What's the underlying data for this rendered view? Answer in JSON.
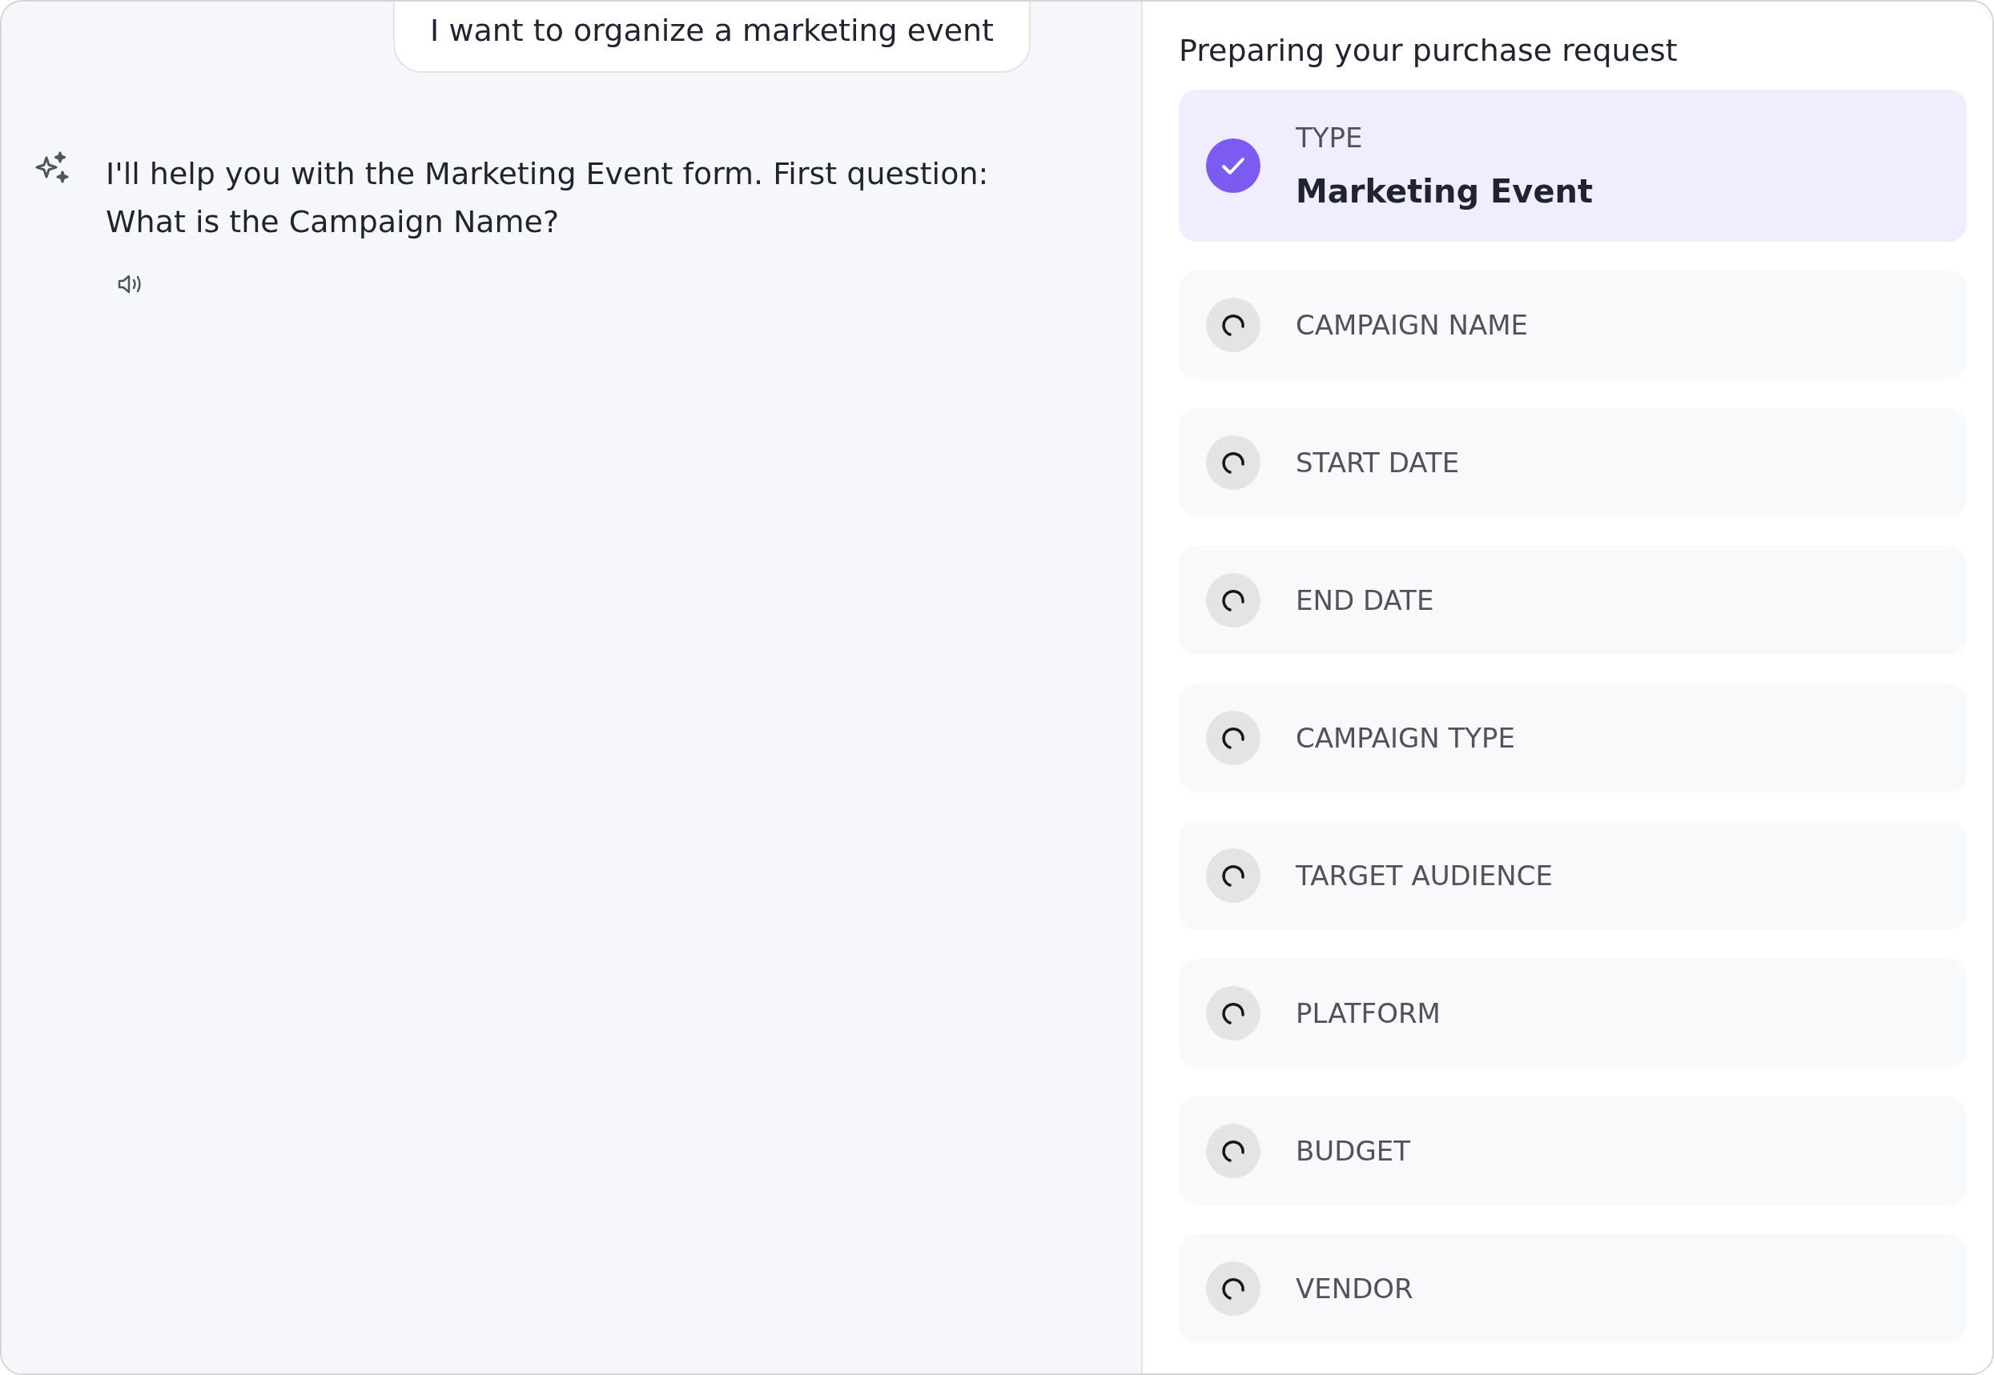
{
  "chat": {
    "user_message": "I want to organize a marketing event",
    "assistant_message": "I'll help you with the Marketing Event form. First question: What is the Campaign Name?"
  },
  "request_panel": {
    "title": "Preparing your purchase request",
    "fields": [
      {
        "label": "TYPE",
        "value": "Marketing Event",
        "completed": true
      },
      {
        "label": "CAMPAIGN NAME",
        "completed": false
      },
      {
        "label": "START DATE",
        "completed": false
      },
      {
        "label": "END DATE",
        "completed": false
      },
      {
        "label": "CAMPAIGN TYPE",
        "completed": false
      },
      {
        "label": "TARGET AUDIENCE",
        "completed": false
      },
      {
        "label": "PLATFORM",
        "completed": false
      },
      {
        "label": "BUDGET",
        "completed": false
      },
      {
        "label": "VENDOR",
        "completed": false
      }
    ]
  }
}
